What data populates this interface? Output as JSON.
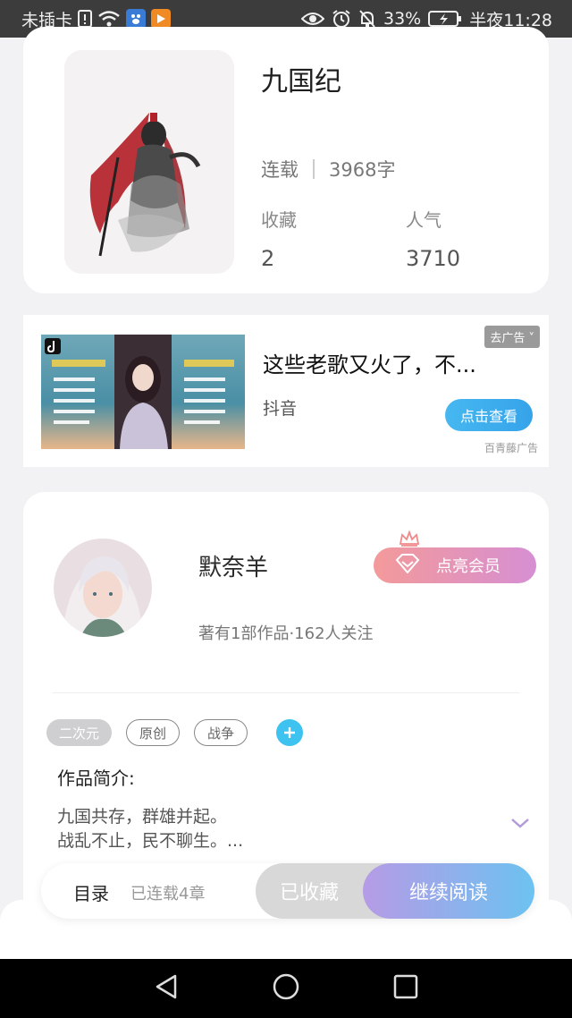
{
  "status_bar": {
    "carrier": "未插卡",
    "battery": "33%",
    "time": "半夜11:28"
  },
  "book": {
    "title": "九国纪",
    "status": "连载",
    "word_count": "3968字",
    "collect_label": "收藏",
    "collect_value": "2",
    "popularity_label": "人气",
    "popularity_value": "3710"
  },
  "ad": {
    "title": "这些老歌又火了，不...",
    "source": "抖音",
    "close_label": "去广告",
    "button_label": "点击查看",
    "brand": "百青藤广告"
  },
  "author": {
    "name": "默奈羊",
    "meta": "著有1部作品·162人关注",
    "vip_label": "点亮会员",
    "tags": [
      "二次元",
      "原创",
      "战争"
    ],
    "intro_heading": "作品简介:",
    "intro_text": "九国共存，群雄并起。\n战乱不止，民不聊生。..."
  },
  "action_bar": {
    "toc_label": "目录",
    "chapter_count": "已连载4章",
    "collected_label": "已收藏",
    "continue_label": "继续阅读"
  },
  "colors": {
    "accent_blue": "#3ec2ef",
    "vip_gradient_start": "#f39a9a",
    "vip_gradient_end": "#d68fd3"
  }
}
